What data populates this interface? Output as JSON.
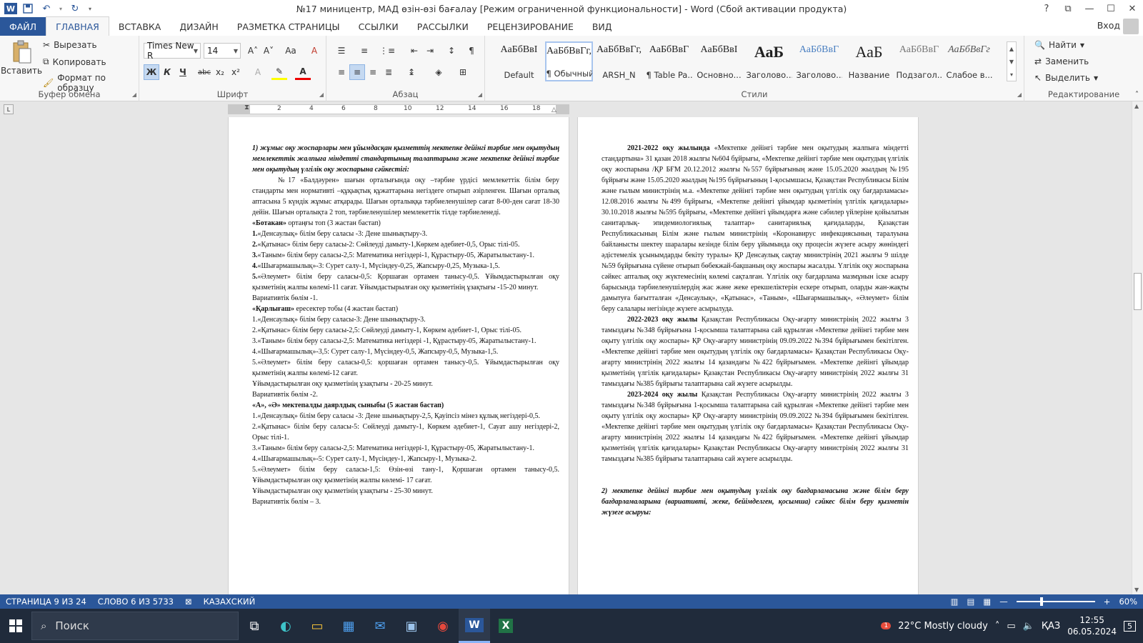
{
  "window": {
    "title": "№17 миницентр, МАД өзін-өзі бағалау [Режим ограниченной функциональности] - Word (Сбой активации продукта)",
    "controls": {
      "help": "?",
      "ribbon_display": "⧉",
      "minimize": "—",
      "maximize": "☐",
      "close": "✕"
    }
  },
  "quick_access": {
    "app_icon": "W",
    "save": "💾",
    "undo": "↶",
    "redo": "↻",
    "customize": "▾"
  },
  "tabs": [
    {
      "label": "ФАЙЛ"
    },
    {
      "label": "ГЛАВНАЯ"
    },
    {
      "label": "ВСТАВКА"
    },
    {
      "label": "ДИЗАЙН"
    },
    {
      "label": "РАЗМЕТКА СТРАНИЦЫ"
    },
    {
      "label": "ССЫЛКИ"
    },
    {
      "label": "РАССЫЛКИ"
    },
    {
      "label": "РЕЦЕНЗИРОВАНИЕ"
    },
    {
      "label": "ВИД"
    }
  ],
  "login": "Вход",
  "clipboard": {
    "paste": "Вставить",
    "cut": "Вырезать",
    "copy": "Копировать",
    "format_painter": "Формат по образцу",
    "label": "Буфер обмена"
  },
  "font": {
    "name": "Times New R",
    "size": "14",
    "label": "Шрифт",
    "bold": "Ж",
    "italic": "К",
    "underline": "Ч",
    "strike": "abc",
    "sub": "x₂",
    "sup": "x²",
    "grow": "A˄",
    "shrink": "A˅",
    "case": "Aa",
    "clear": "A"
  },
  "paragraph": {
    "label": "Абзац"
  },
  "styles": {
    "label": "Стили",
    "items": [
      {
        "sample": "АаБбВвІ",
        "name": "Default"
      },
      {
        "sample": "АаБбВвГг,",
        "name": "¶ Обычный"
      },
      {
        "sample": "АаБбВвГг,",
        "name": "ARSH_N"
      },
      {
        "sample": "АаБбВвГ",
        "name": "¶ Table Pa..."
      },
      {
        "sample": "АаБбВвІ",
        "name": "Основно..."
      },
      {
        "sample": "АаБ",
        "name": "Заголово..."
      },
      {
        "sample": "АаБбВвГ",
        "name": "Заголово..."
      },
      {
        "sample": "АаБ",
        "name": "Название"
      },
      {
        "sample": "АаБбВвГ",
        "name": "Подзагол..."
      },
      {
        "sample": "АаБбВвГг",
        "name": "Слабое в..."
      }
    ]
  },
  "editing": {
    "label": "Редактирование",
    "find": "Найти",
    "replace": "Заменить",
    "select": "Выделить"
  },
  "ruler": {
    "numbers": [
      "2",
      "4",
      "6",
      "8",
      "10",
      "12",
      "14",
      "16",
      "18"
    ]
  },
  "page_left": {
    "lines": [
      {
        "style": "bi",
        "text": "1) жұмыс оқу жоспарлары мен ұйымдасқан қызметтің мектепке дейінгі тәрбие мен оқытудың мемлекеттік жалпыға міндетті стандартының талаптарына және мектепке дейінгі тәрбие мен оқытудың үлгілік оқу жоспарына сәйкестігі:"
      },
      {
        "style": "ind",
        "text": "№17 «Балдәурен» шағын орталығында оқу –тәрбие үрдісі мемлекеттік білім беру стандарты мен нормативті –құқықтық құжаттарына негіздеге отырып әзірленген. Шағын орталық аптасына 5 күндік жұмыс атқарады. Шағын орталыққа тәрбиеленушілер сағат 8-00-ден сағат 18-30 дейін. Шағын орталықта 2 топ, тәрбиеленушілер мемлекеттік тілде тәрбиеленеді."
      },
      {
        "style": "mixed",
        "b": "«Ботакан»",
        "text": " ортаңғы топ (3 жастан бастап)"
      },
      {
        "style": "mixed",
        "b": "1.",
        "text": "«Денсаулық» білім беру саласы -3: Дене шынықтыру-3."
      },
      {
        "style": "mixed",
        "b": "2.",
        "text": "«Қатынас» білім беру саласы-2: Сөйлеуді дамыту-1,Көркем әдебиет-0,5, Орыс тілі-05."
      },
      {
        "style": "mixed",
        "b": "3.",
        "text": "«Таным» білім беру саласы-2,5: Математика негіздері-1, Құрастыру-05, Жаратылыстану-1."
      },
      {
        "style": "mixed",
        "b": "4.",
        "text": "«Шығармашылық»-3: Сурет салу-1, Мүсіндеу-0,25, Жапсыру-0,25, Музыка-1,5."
      },
      {
        "style": "mixed",
        "b": "5.",
        "text": "«Әлеумет» білім беру саласы-0,5: Қоршаған ортамен таныcу-0,5. Ұйымдастырылған оқу қызметінің жалпы көлемі-11 сағат. Ұйымдастырылған оқу қызметінің ұзақтығы -15-20 минут."
      },
      {
        "style": "",
        "text": "Вариативтік бөлім -1."
      },
      {
        "style": "mixed",
        "b": "«Қарлығаш»",
        "text": " ересектер тобы (4 жастан бастап)"
      },
      {
        "style": "",
        "text": "1.«Денсаулық» білім беру саласы-3: Дене шынықтыру-3."
      },
      {
        "style": "",
        "text": "2.«Қатынас» білім беру саласы-2,5: Сөйлеуді дамыту-1, Көркем әдебиет-1, Орыс тілі-05."
      },
      {
        "style": "",
        "text": "3.«Таным» білім беру саласы-2,5: Математика негіздері -1, Құрастыру-05, Жаратылыстану-1."
      },
      {
        "style": "",
        "text": "4.«Шығармашылық»-3,5: Сурет салу-1, Мүсіндеу-0,5, Жапсыру-0,5, Музыка-1,5."
      },
      {
        "style": "",
        "text": "5.«Әлеумет» білім беру саласы-0,5: қоршаған ортамен танысу-0,5. Ұйымдастырылған оқу қызметінің жалпы көлемі-12 сағат."
      },
      {
        "style": "",
        "text": "Ұйымдастырылған оқу қызметінің ұзақтығы - 20-25 минут."
      },
      {
        "style": "",
        "text": "Вариативтік бөлім -2."
      },
      {
        "style": "b",
        "text": "«А», «Ә» мектепалды даярлдық сыныбы (5 жастан бастап)"
      },
      {
        "style": "",
        "text": "1.«Денсаулық» білім беру саласы -3: Дене шынықтыру-2,5, Қауіпсіз мінез құлық негіздері-0,5."
      },
      {
        "style": "",
        "text": "2.«Қатынас» білім беру саласы-5: Сөйлеуді дамыту-1, Көркем әдебиет-1, Сауат ашу негіздері-2, Орыс тілі-1."
      },
      {
        "style": "",
        "text": "3.«Таным» білім беру саласы-2,5: Математика негіздері-1, Құрастыру-05, Жаратылыстану-1."
      },
      {
        "style": "",
        "text": "4.«Шығармашылық»-5: Сурет салу-1, Мүсіндеу-1, Жапсыру-1, Музыка-2."
      },
      {
        "style": "",
        "text": "5.«Әлеумет» білім беру саласы-1,5: Өзін-өзі тану-1, Қоршаған ортамен танысу-0,5. Ұйымдастырылған оқу қызметінің жалпы көлемі- 17 сағат."
      },
      {
        "style": "",
        "text": "Ұйымдастырылған оқу қызметінің ұзақтығы - 25-30 минут."
      },
      {
        "style": "",
        "text": "Вариативтік бөлім – 3."
      }
    ]
  },
  "page_right": {
    "lines": [
      {
        "style": "ind-mixed",
        "b": "2021-2022 оқу жылында",
        "text": " «Мектепке дейінгі тәрбие мен оқытудың жалпыға міндетті стандартына» 31 қазан 2018 жылғы №604 бұйрығы, «Мектепке дейінгі тәрбие мен оқытудың үлгілік оқу жоспарына /ҚР БҒМ 20.12.2012 жылғы №557 бұйрығының және 15.05.2020 жылдың №195 бұйрығы және 15.05.2020 жылдың №195 бұйрығының 1-қосымшасы, Қазақстан Республикасы Білім және ғылым министрінің м.а. «Мектепке дейінгі тәрбие мен оқытудың үлгілік оқу бағдарламасы» 12.08.2016 жылғы №499 бұйрығы, «Мектепке дейінгі ұйымдар қызметінің үлгілік қағидалары» 30.10.2018 жылғы №595 бұйрығы, «Мектепке дейінгі ұйымдарға және сәбилер үйлеріне қойылатын санитарлық- эпидемиологиялық талаптар» санитариялық қағидаларды, Қазақстан Республикасының Білім және ғылым министрінің «Коронавирус инфекциясының таралуына байланысты шектеу шаралары кезінде білім беру ұйымында оқу процесін жүзеге асыру жөніндегі әдістемелік ұсынымдарды бекіту туралы» ҚР Денсаулық сақтау министрінің 2021 жылғы 9 шілде №59 бұйрығына сүйене отырып бөбекжай-бақшаның оқу жоспары жасалды. Үлгілік оқу жоспарына сәйкес апталық оқу жүктемесінің көлемі сақталған. Үлгілік оқу бағдарлама мазмұнын іске асыру барысында тәрбиеленушілердің жас және жеке ерекшеліктерін ескере отырып, оларды жан-жақты дамытуға бағытталған «Денсаулық», «Қатынас», «Таным», «Шығармашылық», «Әлеумет» білім беру салалары негізінде жүзеге асырылуда."
      },
      {
        "style": "ind-mixed",
        "b": "2022-2023 оқу жылы",
        "text": " Қазақстан Республикасы Оқу-ағарту министрінің 2022 жылғы 3 тамыздағы №348 бұйрығына 1-қосымша талаптарына сай құрылған «Мектепке дейінгі тәрбие мен оқыту үлгілік оқу жоспары» ҚР Оқу-ағарту министрінің 09.09.2022 №394 бұйрығымен бекітілген. «Мектепке дейінгі тәрбие мен оқытудың үлгілік оқу бағдарламасы» Қазақстан Республикасы Оқу-ағарту министрінің 2022 жылғы 14 қазандағы №422 бұйрығымен. «Мектепке дейінгі ұйымдар қызметінің үлгілік қағидалары» Қазақстан Республикасы Оқу-ағарту министрінің 2022 жылғы 31 тамыздағы №385 бұйрығы талаптарына сай жүзеге асырылды."
      },
      {
        "style": "ind-mixed",
        "b": "2023-2024 оқу жылы",
        "text": " Қазақстан Республикасы Оқу-ағарту министрінің 2022 жылғы 3 тамыздағы №348 бұйрығына 1-қосымша талаптарына сай құрылған «Мектепке дейінгі тәрбие мен оқыту үлгілік оқу жоспары» ҚР Оқу-ағарту министрінің 09.09.2022 №394 бұйрығымен бекітілген. «Мектепке дейінгі тәрбие мен оқытудың үлгілік оқу бағдарламасы» Қазақстан Республикасы Оқу-ағарту министрінің 2022 жылғы 14 қазандағы №422 бұйрығымен. «Мектепке дейінгі ұйымдар қызметінің үлгілік қағидалары» Қазақстан Республикасы Оқу-ағарту министрінің 2022 жылғы 31 тамыздағы №385 бұйрығы талаптарына сай жүзеге асырылды."
      },
      {
        "style": "gap",
        "text": ""
      },
      {
        "style": "bi",
        "text": "2) мектепке дейінгі тәрбие мен оқытудың үлгілік оқу бағдарламасына және білім беру бағдарламаларына (вариативті, жеке, бейімделген, қосымша) сәйкес білім беру қызметін жүзеге асыруы:"
      }
    ]
  },
  "statusbar": {
    "page": "СТРАНИЦА 9 ИЗ 24",
    "words": "СЛОВО 6 ИЗ 5733",
    "language": "КАЗАХСКИЙ",
    "zoom": "60%",
    "zoom_fraction": 0.6
  },
  "taskbar": {
    "search_placeholder": "Поиск",
    "weather": "22°C  Mostly cloudy",
    "lang": "ҚАЗ",
    "time": "12:55",
    "date": "06.05.2024",
    "notifications": "5",
    "weather_badge": "1"
  },
  "colors": {
    "accent": "#2b579a",
    "taskbar": "#202b3b"
  }
}
